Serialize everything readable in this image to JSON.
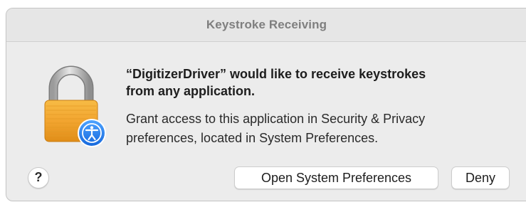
{
  "dialog": {
    "title": "Keystroke Receiving",
    "heading_line1": "“DigitizerDriver” would like to receive keystrokes",
    "heading_line2": "from any application.",
    "message_line1": "Grant access to this application in Security & Privacy",
    "message_line2": "preferences, located in System Preferences.",
    "help_label": "?",
    "open_prefs_label": "Open System Preferences",
    "deny_label": "Deny"
  },
  "icons": {
    "main": "lock-icon",
    "badge": "accessibility-icon"
  },
  "colors": {
    "lock_body": "#f2a530",
    "badge": "#1a7cf2"
  }
}
